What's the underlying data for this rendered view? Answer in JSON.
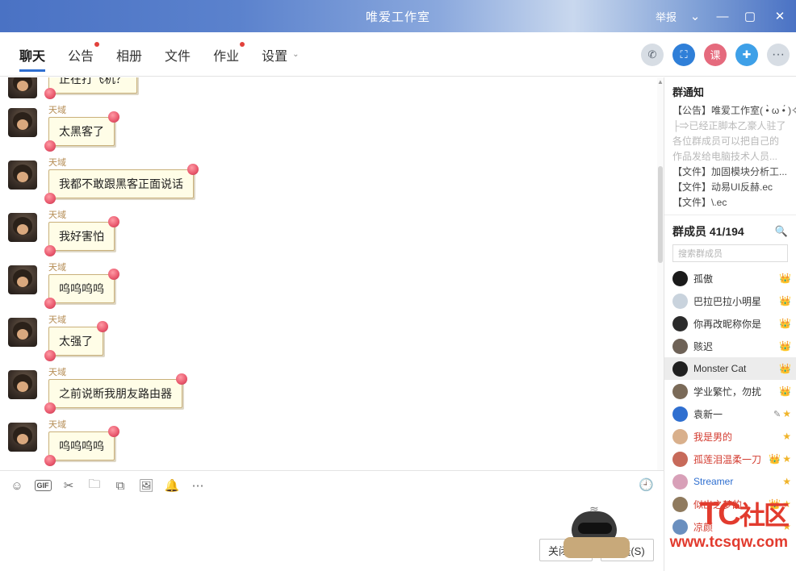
{
  "window": {
    "title": "唯爱工作室",
    "report_label": "举报",
    "chevron": "⌄",
    "minimize": "—",
    "maximize": "▢",
    "close": "✕"
  },
  "tabs": [
    {
      "label": "聊天",
      "active": true,
      "dot": false
    },
    {
      "label": "公告",
      "active": false,
      "dot": true
    },
    {
      "label": "相册",
      "active": false,
      "dot": false
    },
    {
      "label": "文件",
      "active": false,
      "dot": false
    },
    {
      "label": "作业",
      "active": false,
      "dot": true
    },
    {
      "label": "设置",
      "active": false,
      "dot": false,
      "chevron": "⌄"
    }
  ],
  "toolbar_icons": [
    {
      "name": "phone-icon",
      "glyph": "✆",
      "style": "grey"
    },
    {
      "name": "video-call-icon",
      "glyph": "⛶",
      "style": "blue"
    },
    {
      "name": "course-icon",
      "glyph": "课",
      "style": "pink"
    },
    {
      "name": "add-app-icon",
      "glyph": "✚",
      "style": "lblue"
    },
    {
      "name": "more-icon",
      "glyph": "···",
      "style": "dots"
    }
  ],
  "chat": {
    "messages": [
      {
        "sender": "",
        "text": "正在打飞机？",
        "partial": true
      },
      {
        "sender": "天域",
        "text": "太黑客了"
      },
      {
        "sender": "天域",
        "text": "我都不敢跟黑客正面说话"
      },
      {
        "sender": "天域",
        "text": "我好害怕"
      },
      {
        "sender": "天域",
        "text": "呜呜呜呜"
      },
      {
        "sender": "天域",
        "text": "太强了"
      },
      {
        "sender": "天域",
        "text": "之前说断我朋友路由器"
      },
      {
        "sender": "天域",
        "text": "呜呜呜呜"
      }
    ]
  },
  "editor": {
    "tools": [
      {
        "name": "emoji-icon",
        "glyph": "☺"
      },
      {
        "name": "gif-icon",
        "glyph": "GIF"
      },
      {
        "name": "screenshot-icon",
        "glyph": "✂"
      },
      {
        "name": "folder-icon",
        "glyph": "🗀"
      },
      {
        "name": "file-transfer-icon",
        "glyph": "⧉"
      },
      {
        "name": "image-icon",
        "glyph": "🖼"
      },
      {
        "name": "shake-icon",
        "glyph": "🔔"
      },
      {
        "name": "more-tools-icon",
        "glyph": "⋯"
      }
    ],
    "history_icon": "🕘",
    "input_value": "",
    "input_placeholder": "",
    "close_button": "关闭(C)",
    "send_button": "发送(S)"
  },
  "right_panel": {
    "notice_title": "群通知",
    "notice_lines": [
      {
        "text": "【公告】唯爱工作室( •̀ ω •́ )✧",
        "faded": false
      },
      {
        "text": "├⇒已经正脚本乙豪人驻了",
        "faded": true
      },
      {
        "text": "各位群成员可以把自己的",
        "faded": true
      },
      {
        "text": "作品发给电脑技术人员...",
        "faded": true
      },
      {
        "text": "【文件】加固模块分析工...",
        "faded": false
      },
      {
        "text": "【文件】动易UI反赫.ec",
        "faded": false
      },
      {
        "text": "【文件】\\.ec",
        "faded": false
      }
    ],
    "members_title": "群成员 41/194",
    "search_icon": "🔍",
    "search_placeholder": "搜索群成员",
    "members": [
      {
        "name": "孤傲",
        "color": "normal",
        "avatar": "#1b1b1b",
        "badges": [
          "crown"
        ]
      },
      {
        "name": "巴拉巴拉小明星",
        "color": "normal",
        "avatar": "#c9d3dd",
        "badges": [
          "crown"
        ]
      },
      {
        "name": "你再改昵称你是",
        "color": "normal",
        "avatar": "#2b2b2b",
        "badges": [
          "crown"
        ]
      },
      {
        "name": "赅迟",
        "color": "normal",
        "avatar": "#6e6257",
        "badges": [
          "crown"
        ]
      },
      {
        "name": "Monster Cat",
        "color": "normal",
        "avatar": "#1f1f1f",
        "badges": [
          "crown"
        ],
        "selected": true
      },
      {
        "name": "学业繁忙，勿扰",
        "color": "normal",
        "avatar": "#7a6a58",
        "badges": [
          "crown"
        ]
      },
      {
        "name": "袁新一",
        "color": "normal",
        "avatar": "#2f6fd0",
        "badges": [
          "pen",
          "star"
        ]
      },
      {
        "name": "我是男的",
        "color": "red",
        "avatar": "#d9b08c",
        "badges": [
          "star"
        ]
      },
      {
        "name": "孤莲泪温柔一刀",
        "color": "red",
        "avatar": "#c76a5a",
        "badges": [
          "crown",
          "star"
        ]
      },
      {
        "name": "Streamer",
        "color": "blue",
        "avatar": "#d8a0b8",
        "badges": [
          "star"
        ]
      },
      {
        "name": "似出之梦的",
        "color": "red",
        "avatar": "#8f7a5e",
        "badges": [
          "crown",
          "star"
        ]
      },
      {
        "name": "凉颜",
        "color": "red",
        "avatar": "#6a8fbf",
        "badges": [
          "star"
        ]
      }
    ]
  },
  "watermark": {
    "tc": "TC",
    "community": "社区",
    "url": "www.tcsqw.com"
  }
}
